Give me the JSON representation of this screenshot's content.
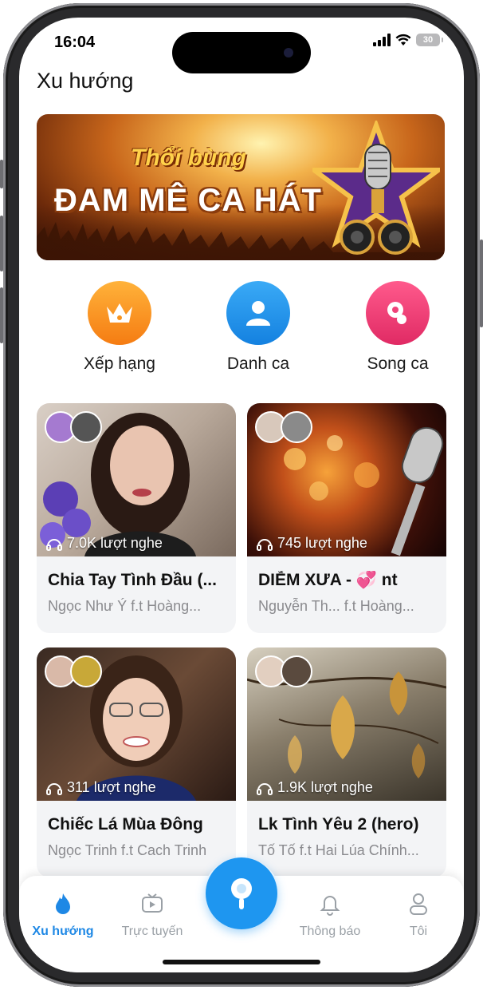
{
  "status_bar": {
    "time": "16:04",
    "battery": "30"
  },
  "header": {
    "title": "Xu hướng"
  },
  "banner": {
    "subtitle": "Thổi bùng",
    "title": "ĐAM MÊ CA HÁT"
  },
  "categories": [
    {
      "label": "Xếp hạng",
      "icon": "crown-icon",
      "color": "#f7931e"
    },
    {
      "label": "Danh ca",
      "icon": "person-icon",
      "color": "#1e96f0"
    },
    {
      "label": "Song ca",
      "icon": "duet-icon",
      "color": "#f0437a"
    }
  ],
  "cards": [
    {
      "plays": "7.0K lượt nghe",
      "title": "Chia Tay Tình Đầu (...",
      "subtitle": "Ngọc Như Ý f.t Hoàng..."
    },
    {
      "plays": "745 lượt nghe",
      "title": "DIỄM XƯA - 💞 nt",
      "subtitle": "Nguyễn Th... f.t Hoàng..."
    },
    {
      "plays": "311 lượt nghe",
      "title": "Chiếc Lá Mùa Đông",
      "subtitle": "Ngọc Trinh f.t Cach Trinh"
    },
    {
      "plays": "1.9K lượt nghe",
      "title": "Lk Tình Yêu 2 (hero)",
      "subtitle": "Tố Tố f.t Hai Lúa Chính..."
    }
  ],
  "tabbar": {
    "items": [
      {
        "label": "Xu hướng",
        "icon": "flame-icon",
        "active": true
      },
      {
        "label": "Trực tuyến",
        "icon": "tv-icon",
        "active": false
      },
      {
        "label": "Thông báo",
        "icon": "bell-icon",
        "active": false
      },
      {
        "label": "Tôi",
        "icon": "profile-icon",
        "active": false
      }
    ],
    "fab_icon": "search-mic-icon",
    "accent": "#1e88e5"
  }
}
